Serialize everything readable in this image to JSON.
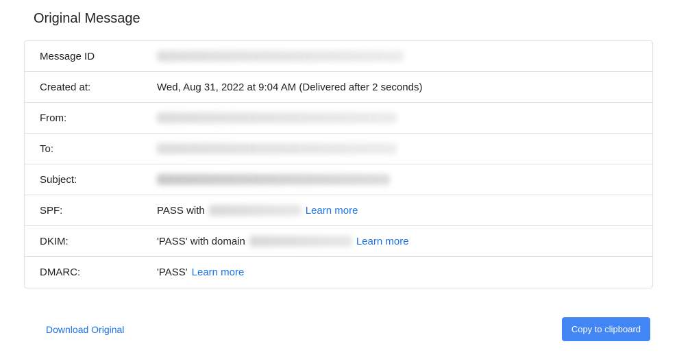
{
  "heading": "Original Message",
  "fields": {
    "message_id": {
      "label": "Message ID"
    },
    "created_at": {
      "label": "Created at:",
      "value": "Wed, Aug 31, 2022 at 9:04 AM (Delivered after 2 seconds)"
    },
    "from": {
      "label": "From:"
    },
    "to": {
      "label": "To:"
    },
    "subject": {
      "label": "Subject:"
    },
    "spf": {
      "label": "SPF:",
      "prefix": "PASS with ",
      "learn_more": "Learn more"
    },
    "dkim": {
      "label": "DKIM:",
      "prefix": "'PASS' with domain ",
      "learn_more": "Learn more"
    },
    "dmarc": {
      "label": "DMARC:",
      "value": "'PASS'  ",
      "learn_more": "Learn more"
    }
  },
  "actions": {
    "download_label": "Download Original",
    "copy_label": "Copy to clipboard"
  },
  "colors": {
    "link": "#1a73e8",
    "button_bg": "#4285f4"
  }
}
